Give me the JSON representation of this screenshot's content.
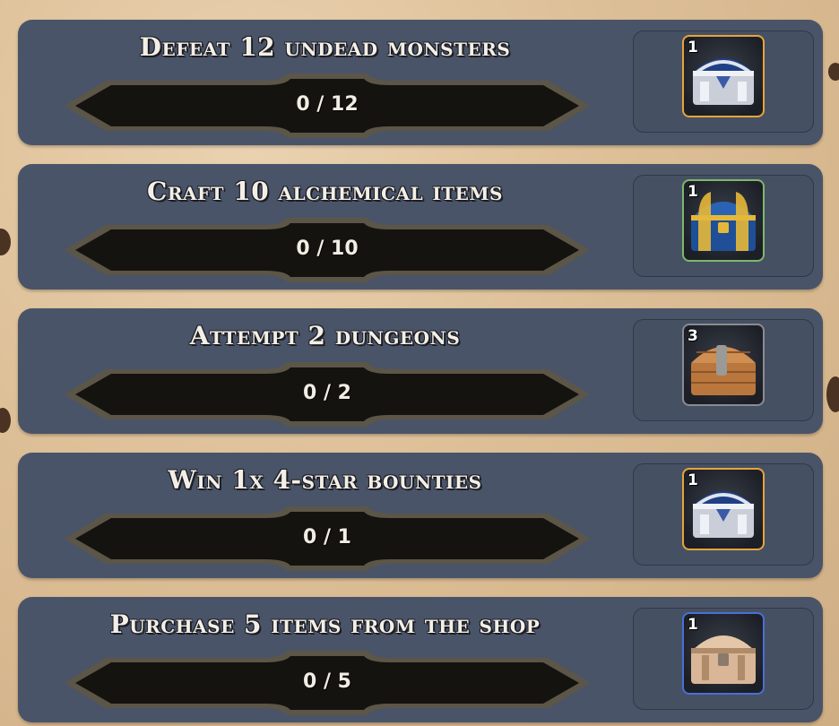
{
  "quests": [
    {
      "title": "Defeat 12 undead monsters",
      "progress": "0 / 12",
      "current": 0,
      "target": 12,
      "reward": {
        "qty": "1",
        "chest": "silver-ornate-chest-icon",
        "frame_color": "#e6a53a"
      }
    },
    {
      "title": "Craft 10 alchemical items",
      "progress": "0 / 10",
      "current": 0,
      "target": 10,
      "reward": {
        "qty": "1",
        "chest": "blue-gold-chest-icon",
        "frame_color": "#7fb86a"
      }
    },
    {
      "title": "Attempt 2 dungeons",
      "progress": "0 / 2",
      "current": 0,
      "target": 2,
      "reward": {
        "qty": "3",
        "chest": "wooden-chest-icon",
        "frame_color": "#8a8c90"
      }
    },
    {
      "title": "Win 1x 4-star bounties",
      "progress": "0 / 1",
      "current": 0,
      "target": 1,
      "reward": {
        "qty": "1",
        "chest": "silver-ornate-chest-icon",
        "frame_color": "#e6a53a"
      }
    },
    {
      "title": "Purchase 5 items from the shop",
      "progress": "0 / 5",
      "current": 0,
      "target": 5,
      "reward": {
        "qty": "1",
        "chest": "pale-wood-chest-icon",
        "frame_color": "#4a6fd6"
      }
    }
  ]
}
